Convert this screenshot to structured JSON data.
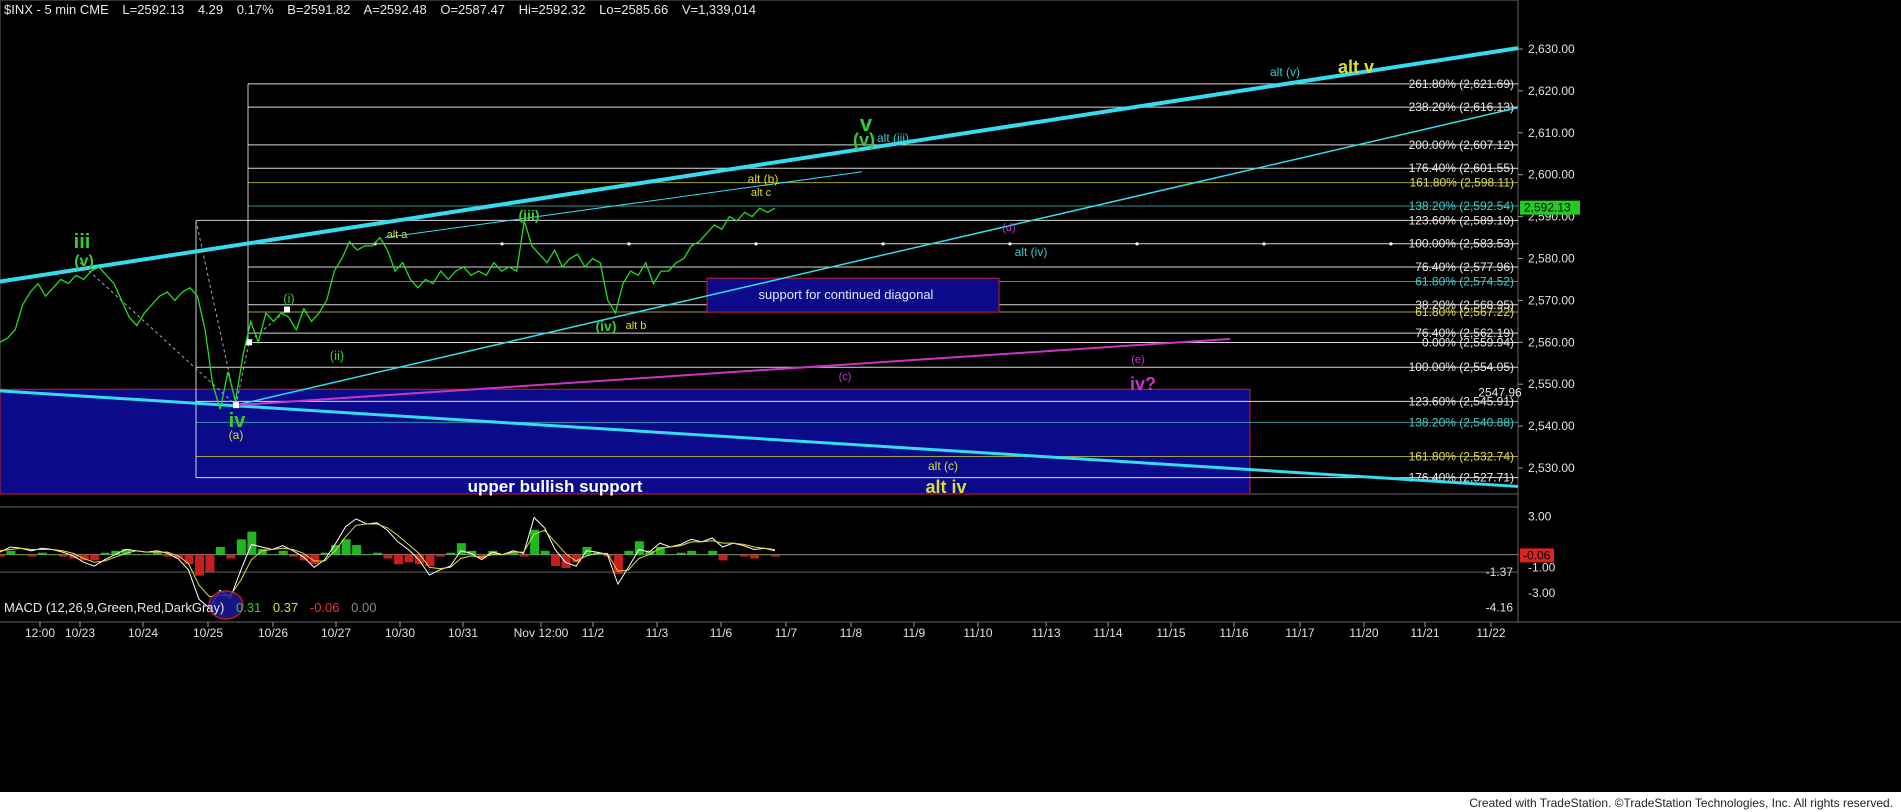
{
  "header": {
    "symbol": "$INX - 5 min CME",
    "last": "L=2592.13",
    "change": "4.29",
    "pct": "0.17%",
    "bid": "B=2591.82",
    "ask": "A=2592.48",
    "open": "O=2587.47",
    "hi": "Hi=2592.32",
    "lo": "Lo=2585.66",
    "vol": "V=1,339,014"
  },
  "macd_header": {
    "name": "MACD (12,26,9,Green,Red,DarkGray)",
    "v1": "0.31",
    "v2": "0.37",
    "v3": "-0.06",
    "v4": "0.00"
  },
  "footer": "Created with TradeStation. ©TradeStation Technologies, Inc. All rights reserved.",
  "colors": {
    "price": "#22dd22",
    "channel": "#33ddee",
    "magenta": "#cc33cc",
    "green_label": "#33cc33",
    "yellow_label": "#dddd33",
    "cyan_label": "#33cccc",
    "support_box": "#0a0a8a",
    "support_border": "#cc2222"
  },
  "chart_data": [
    {
      "type": "line",
      "title": "$INX - 5 min CME",
      "ylim": [
        2522,
        2635
      ],
      "y_ticks": [
        "2,530.00",
        "2,540.00",
        "2,550.00",
        "2,560.00",
        "2,570.00",
        "2,580.00",
        "2,590.00",
        "2,600.00",
        "2,610.00",
        "2,620.00",
        "2,630.00"
      ],
      "y_tick_values": [
        2530,
        2540,
        2550,
        2560,
        2570,
        2580,
        2590,
        2600,
        2610,
        2620,
        2630
      ],
      "x_ticks": [
        "12:00",
        "10/23",
        "10/24",
        "10/25",
        "10/26",
        "10/27",
        "10/30",
        "10/31",
        "Nov 12:00",
        "11/2",
        "11/3",
        "11/6",
        "11/7",
        "11/8",
        "11/9",
        "11/10",
        "11/13",
        "11/14",
        "11/15",
        "11/16",
        "11/17",
        "11/20",
        "11/21",
        "11/22"
      ],
      "last_price_label": "2,592.13",
      "last_price": 2592.13,
      "series": [
        {
          "values": [
            2560,
            2561,
            2563,
            2569,
            2572,
            2574,
            2571,
            2573,
            2575,
            2574,
            2576,
            2575,
            2577,
            2578,
            2576,
            2574,
            2570,
            2566,
            2564,
            2567,
            2569,
            2571,
            2572,
            2570,
            2572,
            2573,
            2571,
            2563,
            2550,
            2544,
            2553,
            2546,
            2557,
            2565,
            2560,
            2567,
            2565,
            2567,
            2566,
            2563,
            2568,
            2565,
            2567,
            2570,
            2577,
            2580,
            2584,
            2582,
            2583,
            2583,
            2585,
            2582,
            2577,
            2579,
            2575,
            2573,
            2575,
            2574,
            2577,
            2575,
            2577,
            2578,
            2576,
            2577,
            2576,
            2579,
            2577,
            2578,
            2577,
            2589,
            2583,
            2581,
            2579,
            2582,
            2578,
            2580,
            2581,
            2578,
            2580,
            2579,
            2570,
            2567,
            2574,
            2577,
            2576,
            2579,
            2574,
            2577,
            2577,
            2579,
            2580,
            2583,
            2584,
            2586,
            2588,
            2587,
            2590,
            2589,
            2591,
            2590,
            2592,
            2591,
            2592
          ]
        }
      ],
      "fib_levels": [
        {
          "label": "261.80% (2,621.69)",
          "value": 2621.69
        },
        {
          "label": "238.20% (2,616.13)",
          "value": 2616.13
        },
        {
          "label": "200.00% (2,607.12)",
          "value": 2607.12
        },
        {
          "label": "176.40% (2,601.55)",
          "value": 2601.55
        },
        {
          "label": "161.80% (2,598.11)",
          "value": 2598.11
        },
        {
          "label": "138.20% (2,592.54)",
          "value": 2592.54
        },
        {
          "label": "123.60% (2,589.10)",
          "value": 2589.1
        },
        {
          "label": "100.00% (2,583.53)",
          "value": 2583.53
        },
        {
          "label": "76.40% (2,577.96)",
          "value": 2577.96
        },
        {
          "label": "61.80% (2,574.52)",
          "value": 2574.52
        },
        {
          "label": "38.20% (2,568.95)",
          "value": 2568.95
        },
        {
          "label": "61.80% (2,567.22)",
          "value": 2567.22
        },
        {
          "label": "76.40% (2,562.19)",
          "value": 2562.19
        },
        {
          "label": "0.00% (2,559.94)",
          "value": 2559.94
        },
        {
          "label": "100.00% (2,554.05)",
          "value": 2554.05
        },
        {
          "label": "123.60% (2,545.91)",
          "value": 2545.91
        },
        {
          "label": "138.20% (2,540.88)",
          "value": 2540.88
        },
        {
          "label": "161.80% (2,532.74)",
          "value": 2532.74
        },
        {
          "label": "176.40% (2,527.71)",
          "value": 2527.71
        }
      ],
      "level_label_2547": "2547.96",
      "annotations": {
        "iii": "iii",
        "v_paren_left": "(v)",
        "iv": "iv",
        "a_paren": "(a)",
        "i_paren": "(i)",
        "ii_paren": "(ii)",
        "iii_paren": "(iii)",
        "iv_paren": "(iv)",
        "v_big": "v",
        "v_paren": "(v)",
        "alt_iii": "alt (iii)",
        "alt_a": "alt a",
        "alt_b": "alt b",
        "alt_b_paren": "alt (b)",
        "alt_c": "alt c",
        "alt_v_paren": "alt (v)",
        "alt_v": "alt v",
        "alt_iv_paren": "alt (iv)",
        "d_paren": "(d)",
        "c_paren": "(c)",
        "e_paren": "(e)",
        "iv_q": "iv?",
        "alt_c_paren": "alt (c)",
        "alt_iv": "alt iv",
        "support_diag": "support for continued diagonal",
        "upper_support": "upper bullish support"
      }
    },
    {
      "type": "line",
      "title": "MACD (12,26,9,Green,Red,DarkGray)",
      "ylim": [
        -4.5,
        3.5
      ],
      "y_ticks": [
        "3.00",
        "-1.00",
        "-3.00"
      ],
      "y_tick_values": [
        3,
        -1,
        -3
      ],
      "value_labels": [
        "-0.06",
        "-1.37",
        "-4.16"
      ],
      "value_label_values": [
        -0.06,
        -1.37,
        -4.16
      ],
      "macd": [
        0.2,
        0.6,
        0.5,
        0.3,
        0.5,
        0.4,
        0.2,
        -0.1,
        -0.6,
        -0.9,
        -0.4,
        0.0,
        0.4,
        0.3,
        0.2,
        0.3,
        0.1,
        -0.3,
        -1.2,
        -3.5,
        -4.2,
        -2.8,
        -3.4,
        -1.2,
        0.8,
        0.6,
        0.4,
        0.7,
        0.3,
        -0.2,
        -1.0,
        -0.4,
        0.8,
        2.2,
        2.8,
        2.4,
        2.5,
        1.9,
        1.0,
        0.4,
        -0.4,
        -1.6,
        -1.2,
        -0.9,
        0.3,
        0.1,
        -0.4,
        0.2,
        0.0,
        0.3,
        0.1,
        2.9,
        2.1,
        0.4,
        -0.6,
        -0.9,
        0.3,
        0.2,
        0.0,
        -2.3,
        -1.0,
        0.4,
        0.2,
        0.9,
        0.6,
        0.8,
        1.2,
        1.0,
        1.3,
        0.6,
        0.9,
        0.7,
        0.4,
        0.5,
        0.3
      ],
      "signal": [
        0.3,
        0.4,
        0.5,
        0.4,
        0.4,
        0.4,
        0.3,
        0.1,
        -0.3,
        -0.6,
        -0.5,
        -0.2,
        0.1,
        0.3,
        0.2,
        0.2,
        0.2,
        -0.1,
        -0.7,
        -2.4,
        -3.3,
        -3.2,
        -3.2,
        -2.0,
        -0.4,
        0.3,
        0.4,
        0.5,
        0.4,
        0.1,
        -0.5,
        -0.5,
        0.3,
        1.4,
        2.3,
        2.4,
        2.4,
        2.1,
        1.5,
        0.8,
        0.1,
        -1.0,
        -1.1,
        -1.0,
        -0.3,
        -0.1,
        -0.2,
        0.0,
        0.0,
        0.2,
        0.2,
        1.6,
        1.9,
        1.0,
        0.1,
        -0.5,
        -0.1,
        0.1,
        0.1,
        -1.3,
        -1.2,
        -0.3,
        0.0,
        0.5,
        0.6,
        0.7,
        1.0,
        1.0,
        1.1,
        0.9,
        0.9,
        0.8,
        0.6,
        0.5,
        0.4
      ]
    }
  ]
}
